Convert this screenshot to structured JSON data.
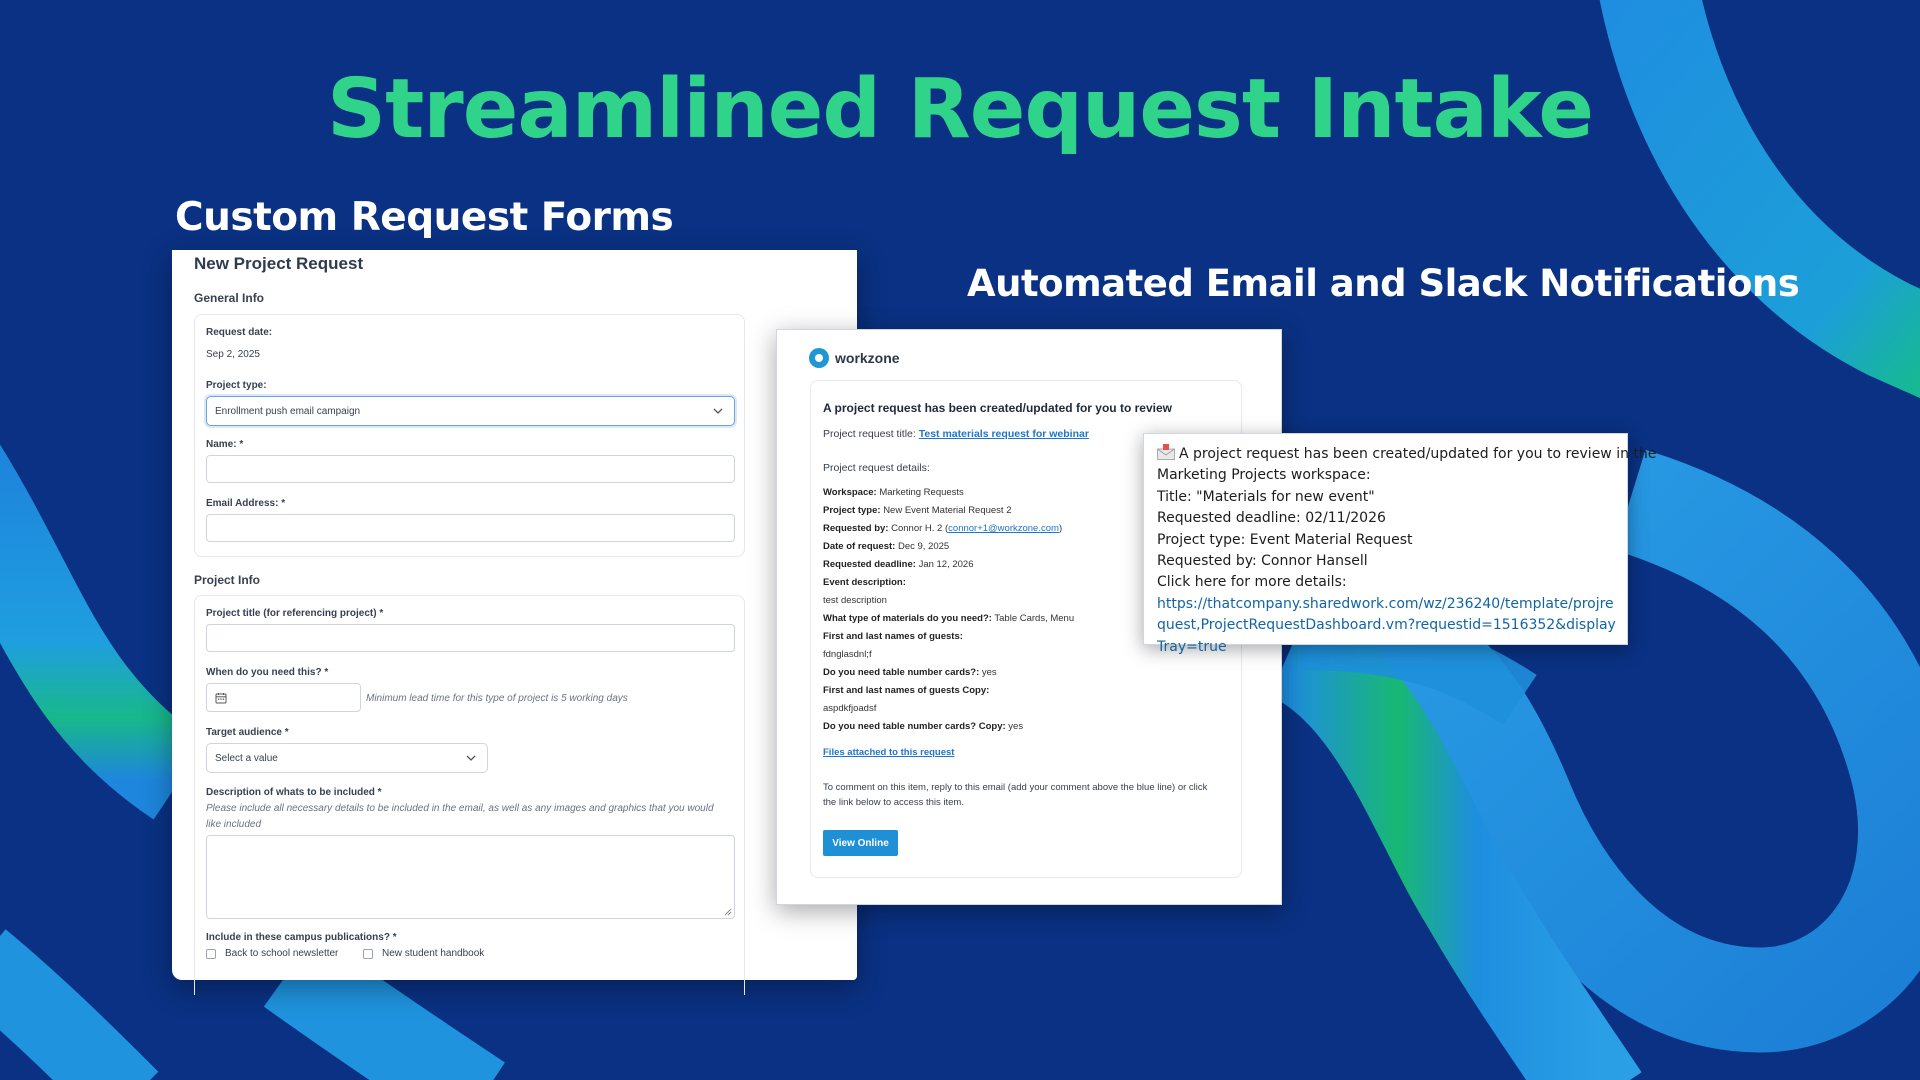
{
  "headline": "Streamlined Request Intake",
  "sections": {
    "forms_title": "Custom Request Forms",
    "notifications_title": "Automated Email and Slack Notifications"
  },
  "colors": {
    "background": "#0a3183",
    "headline": "#2fd48a",
    "ribbon_blue": "#1f8fdc",
    "ribbon_green": "#16c37a",
    "link": "#1e75c9"
  },
  "form": {
    "title": "New Project Request",
    "general_info_label": "General Info",
    "request_date_label": "Request date:",
    "request_date_value": "Sep 2, 2025",
    "project_type_label": "Project type:",
    "project_type_value": "Enrollment push email campaign",
    "name_label": "Name: *",
    "email_label": "Email Address: *",
    "project_info_label": "Project Info",
    "project_title_label": "Project title (for referencing project) *",
    "when_label": "When do you need this? *",
    "lead_time_hint": "Minimum lead time for this type of project is 5 working days",
    "audience_label": "Target audience *",
    "audience_placeholder": "Select a value",
    "description_label": "Description of whats to be included *",
    "description_hint": "Please include all necessary details to be included in the email, as well as any images and graphics that you would like included",
    "publications_label": "Include in these campus publications? *",
    "publications_options": [
      "Back to school newsletter",
      "New student handbook"
    ],
    "icons": {
      "calendar": "calendar-icon",
      "dropdown": "chevron-down-icon"
    }
  },
  "email": {
    "brand": "workzone",
    "heading": "A project request has been created/updated for you to review",
    "title_label": "Project request title:",
    "title_link": "Test materials request for webinar",
    "details_label": "Project request details:",
    "details": [
      {
        "label": "Workspace:",
        "value": "Marketing Requests"
      },
      {
        "label": "Project type:",
        "value": "New Event Material Request 2"
      },
      {
        "label": "Requested by:",
        "value": "Connor H. 2",
        "link": "connor+1@workzone.com"
      },
      {
        "label": "Date of request:",
        "value": "Dec 9, 2025"
      },
      {
        "label": "Requested deadline:",
        "value": "Jan 12, 2026"
      },
      {
        "label": "Event description:",
        "value": ""
      },
      {
        "label": "",
        "value": "test description"
      },
      {
        "label": "What type of materials do you need?:",
        "value": "Table Cards, Menu"
      },
      {
        "label": "First and last names of guests:",
        "value": ""
      },
      {
        "label": "",
        "value": "fdnglasdnl;f"
      },
      {
        "label": "Do you need table number cards?:",
        "value": "yes"
      },
      {
        "label": "First and last names of guests Copy:",
        "value": ""
      },
      {
        "label": "",
        "value": "aspdkfjoadsf"
      },
      {
        "label": "Do you need table number cards? Copy:",
        "value": "yes"
      }
    ],
    "files_link": "Files attached to this request",
    "comment": "To comment on this item, reply to this email (add your comment above the blue line) or click the link below to access this item.",
    "button": "View Online"
  },
  "slack": {
    "icon": "envelope-icon",
    "lines": [
      "A project request has been created/updated for you to review in the",
      "Marketing Projects workspace:",
      "Title: \"Materials for new event\"",
      "Requested deadline: 02/11/2026",
      "Project type: Event Material Request",
      "Requested by: Connor Hansell",
      "Click here for more details:"
    ],
    "link": "https://thatcompany.sharedwork.com/wz/236240/template/projrequest,ProjectRequestDashboard.vm?requestid=1516352&displayTray=true"
  }
}
